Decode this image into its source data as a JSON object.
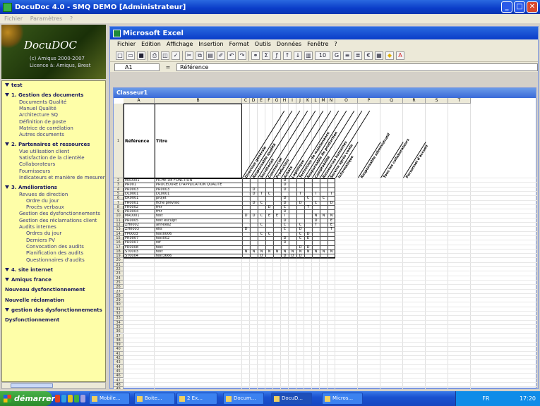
{
  "app_window": {
    "title": "DocuDoc 4.0 - SMQ DEMO [Administrateur]"
  },
  "app_menu": [
    "Fichier",
    "Paramètres",
    "?"
  ],
  "logo": {
    "name": "DocuDOC",
    "line1": "(c) Amiqus 2000-2007",
    "line2": "Licence à: Amiqus, Brest"
  },
  "tree": [
    {
      "label": "test",
      "level": 0,
      "bold": true,
      "expanded": true
    },
    {
      "label": "1. Gestion des documents",
      "level": 0,
      "bold": true,
      "expanded": true
    },
    {
      "label": "Documents Qualité",
      "level": 1
    },
    {
      "label": "Manuel Qualité",
      "level": 1
    },
    {
      "label": "Architecture SQ",
      "level": 1
    },
    {
      "label": "Définition de poste",
      "level": 1
    },
    {
      "label": "Matrice de corrélation",
      "level": 1
    },
    {
      "label": "Autres documents",
      "level": 1
    },
    {
      "label": "2. Partenaires et ressources",
      "level": 0,
      "bold": true,
      "expanded": true
    },
    {
      "label": "Vue utilisation client",
      "level": 1
    },
    {
      "label": "Satisfaction de la clientèle",
      "level": 1
    },
    {
      "label": "Collaborateurs",
      "level": 1
    },
    {
      "label": "Fournisseurs",
      "level": 1
    },
    {
      "label": "Indicateurs et manière de mesurer",
      "level": 1
    },
    {
      "label": "3. Améliorations",
      "level": 0,
      "bold": true,
      "expanded": true
    },
    {
      "label": "Revues de direction",
      "level": 1
    },
    {
      "label": "Ordre du jour",
      "level": 2
    },
    {
      "label": "Procès verbaux",
      "level": 2
    },
    {
      "label": "Gestion des dysfonctionnements",
      "level": 1
    },
    {
      "label": "Gestion des réclamations client",
      "level": 1
    },
    {
      "label": "Audits internes",
      "level": 1
    },
    {
      "label": "Ordres du jour",
      "level": 2
    },
    {
      "label": "Derniers PV",
      "level": 2
    },
    {
      "label": "Convocation des audits",
      "level": 2
    },
    {
      "label": "Planification des audits",
      "level": 2
    },
    {
      "label": "Questionnaires d'audits",
      "level": 2
    },
    {
      "label": "4. site internet",
      "level": 0,
      "bold": true,
      "expanded": true
    },
    {
      "label": "Amiqus france",
      "level": 0,
      "bold": true,
      "expanded": true
    },
    {
      "label": "Nouveau dysfonctionnement",
      "level": 0,
      "bold": true
    },
    {
      "label": "Nouvelle réclamation",
      "level": 0,
      "bold": true
    },
    {
      "label": "gestion des dysfonctionnements",
      "level": 0,
      "bold": true,
      "expanded": true
    },
    {
      "label": "Dysfonctionnement",
      "level": 0,
      "bold": true
    }
  ],
  "excel": {
    "title": "Microsoft Excel",
    "menu": [
      "Fichier",
      "Edition",
      "Affichage",
      "Insertion",
      "Format",
      "Outils",
      "Données",
      "Fenêtre",
      "?"
    ],
    "name_box": "A1",
    "formula_value": "Référence",
    "font_size": "10",
    "workbook_title": "Classeur1",
    "columns": [
      "A",
      "B",
      "C",
      "D",
      "E",
      "F",
      "G",
      "H",
      "I",
      "J",
      "K",
      "L",
      "M",
      "N",
      "O",
      "P",
      "Q",
      "R",
      "S",
      "T"
    ],
    "header_cells": {
      "a": "Référence",
      "b": "Titre"
    },
    "rotated_headers": [
      "Direction générale",
      "Responsable qualité",
      "Secrétariat",
      "Commercial",
      "Production",
      "Achats",
      "Logistique",
      "Technicien de maintenance",
      "Responsable de production",
      "Comptabilité",
      "Ressources humaines",
      "Service après vente",
      "Informatique",
      "Responsable administratif",
      "Tous les collaborateurs",
      "Personnel d'accueil"
    ],
    "rows": [
      {
        "ref": "MR0001",
        "title": "FICHE DE FONCTION",
        "marks": {
          "H": "D"
        }
      },
      {
        "ref": "PR001",
        "title": "PROCEDURE D'APPLICATION QUALITE",
        "marks": {
          "H": "D"
        }
      },
      {
        "ref": "PR0003",
        "title": "PR0003",
        "marks": {
          "D": "D",
          "H": "D"
        }
      },
      {
        "ref": "DL0001",
        "title": "DL0001",
        "marks": {
          "D": "D",
          "E": "T",
          "F": "C",
          "J": "T",
          "L": "I",
          "N": "I"
        }
      },
      {
        "ref": "ER0001",
        "title": "projet",
        "marks": {
          "H": "D",
          "K": "C",
          "M": "C"
        }
      },
      {
        "ref": "FR0001",
        "title": "fiche prévisio",
        "marks": {
          "D": "D",
          "E": "C",
          "H": "D",
          "J": "D",
          "L": "C",
          "N": "D"
        }
      },
      {
        "ref": "FR0002",
        "title": "fmr",
        "marks": {
          "F": "D",
          "H": "C",
          "K": "T"
        }
      },
      {
        "ref": "PR0004",
        "title": "fmr",
        "marks": {
          "H": "D"
        }
      },
      {
        "ref": "MR0001",
        "title": "test",
        "marks": {
          "C": "D",
          "D": "D",
          "E": "C",
          "F": "E",
          "G": "E",
          "H": "I",
          "L": "N",
          "M": "N",
          "N": "N"
        }
      },
      {
        "ref": "PR0005",
        "title": "test esculpt",
        "marks": {
          "H": "D",
          "L": "D",
          "N": "E"
        }
      },
      {
        "ref": "ZH0002",
        "title": "annexe2",
        "marks": {
          "E": "C",
          "H": "C",
          "J": "C",
          "L": "T",
          "N": "E"
        }
      },
      {
        "ref": "ZH0003",
        "title": "eks",
        "marks": {
          "C": "D",
          "H": "C",
          "J": "D",
          "N": "T"
        }
      },
      {
        "ref": "FP0003",
        "title": "test0006",
        "marks": {
          "E": "C",
          "F": "C",
          "J": "C",
          "K": "D"
        }
      },
      {
        "ref": "PR0007",
        "title": "test002",
        "marks": {
          "H": "D",
          "J": "C",
          "K": "E"
        }
      },
      {
        "ref": "FR0007",
        "title": "ref",
        "marks": {
          "H": "D"
        }
      },
      {
        "ref": "FR0008",
        "title": "test",
        "marks": {
          "J": "D",
          "K": "D"
        }
      },
      {
        "ref": "ST0003",
        "title": "test",
        "marks": {
          "C": "N",
          "D": "N",
          "E": "N",
          "F": "N",
          "G": "N",
          "H": "N",
          "I": "N",
          "J": "N",
          "K": "N",
          "L": "N",
          "M": "N",
          "N": "N"
        }
      },
      {
        "ref": "ST0004",
        "title": "test3666",
        "marks": {
          "E": "D",
          "H": "D",
          "I": "D",
          "J": "D"
        }
      }
    ]
  },
  "taskbar": {
    "start_label": "démarrer",
    "tasks": [
      "Mobile...",
      "Boite...",
      "2 Ex...",
      "Docum...",
      "DocuD...",
      "Micros..."
    ],
    "clock": "17:20",
    "lang": "FR"
  }
}
